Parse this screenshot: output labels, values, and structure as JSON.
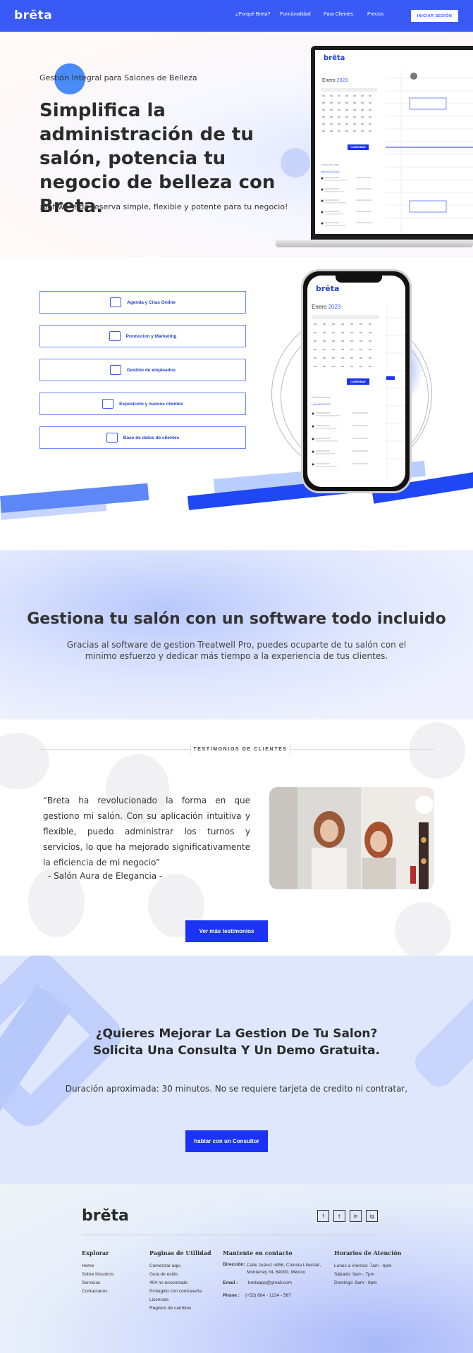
{
  "nav": {
    "logo": "brĕta",
    "links": [
      "¿Porqué Breta?",
      "Funcionalidad",
      "Para Clientes",
      "Precios"
    ],
    "login": "INICIAR SESIÓN"
  },
  "hero": {
    "eyebrow": "Gestión Integral para Salones de Belleza",
    "title": "Simplifica la administración de tu salón, potencia tu negocio de belleza con Breta.",
    "subtitle": "¡Software de reserva simple, flexible y potente para tu negocio!"
  },
  "mock": {
    "logo": "brĕta",
    "month": "Enero",
    "year": "2023",
    "confirm": "CONFIRMAR",
    "upcoming": "Próximas citas",
    "date": "Hoy 8/01/2024"
  },
  "features": [
    {
      "icon": "calendar-icon",
      "label": "Agenda y Citas Online"
    },
    {
      "icon": "megaphone-icon",
      "label": "Promocion y Marketing"
    },
    {
      "icon": "employees-icon",
      "label": "Gestión de empleados"
    },
    {
      "icon": "customer-icon",
      "label": "Exposición y nuevos clientes"
    },
    {
      "icon": "database-icon",
      "label": "Base de datos de clientes"
    }
  ],
  "section3": {
    "title": "Gestiona tu salón con un software todo incluido",
    "text": "Gracias al software de gestion Treatwell Pro, puedes ocuparte de tu salón con el minimo esfuerzo y dedicar más tiempo a la experiencia de tus clientes."
  },
  "testimonials": {
    "label": "TESTIMONIOS DE CLIENTES",
    "quote": "“Breta ha revolucionado la forma en que gestiono mi salón. Con su aplicación intuitiva y flexible, puedo administrar los turnos y servicios, lo que ha mejorado significativamente la eficiencia de mi negocio”",
    "author": "- Salón Aura de Elegancia -",
    "button": "Ver más testimonios"
  },
  "cta": {
    "title_line1": "¿Quieres Mejorar La Gestion De Tu Salon?",
    "title_line2": "Solicita Una Consulta Y Un Demo Gratuita.",
    "text": "Duración aproximada: 30 minutos. No se requiere tarjeta de credito ni contratar,",
    "button": "hablar con un Consultor"
  },
  "footer": {
    "logo": "brĕta",
    "social": [
      "f",
      "t",
      "in",
      "ig"
    ],
    "explorar": {
      "title": "Explorar",
      "items": [
        "Home",
        "Sobre Nosotros",
        "Servicios",
        "Contactanos"
      ]
    },
    "utilidad": {
      "title": "Paginas de Utilidad",
      "items": [
        "Comenzar aqui",
        "Guia de estilo",
        "404 no encontrado",
        "Protegido con contraseña",
        "Licencias",
        "Registro de cambios"
      ]
    },
    "contacto": {
      "title": "Mantente en contacto",
      "dir_label": "Dirección:",
      "dir": "Calle Juárez #456, Colonia Libertad, Monterrey NL 64000, México",
      "email_label": "Email :",
      "email": "bretaapp@gmail.com",
      "phone_label": "Phone :",
      "phone": "(+52) 664 - 1234 - 567"
    },
    "horarios": {
      "title": "Horarios de Atención",
      "items": [
        "Lunes a Viernes: 7am - 6pm",
        "Sábado: 9am - 7pm",
        "Domingo: 9am - 6pm"
      ]
    }
  }
}
